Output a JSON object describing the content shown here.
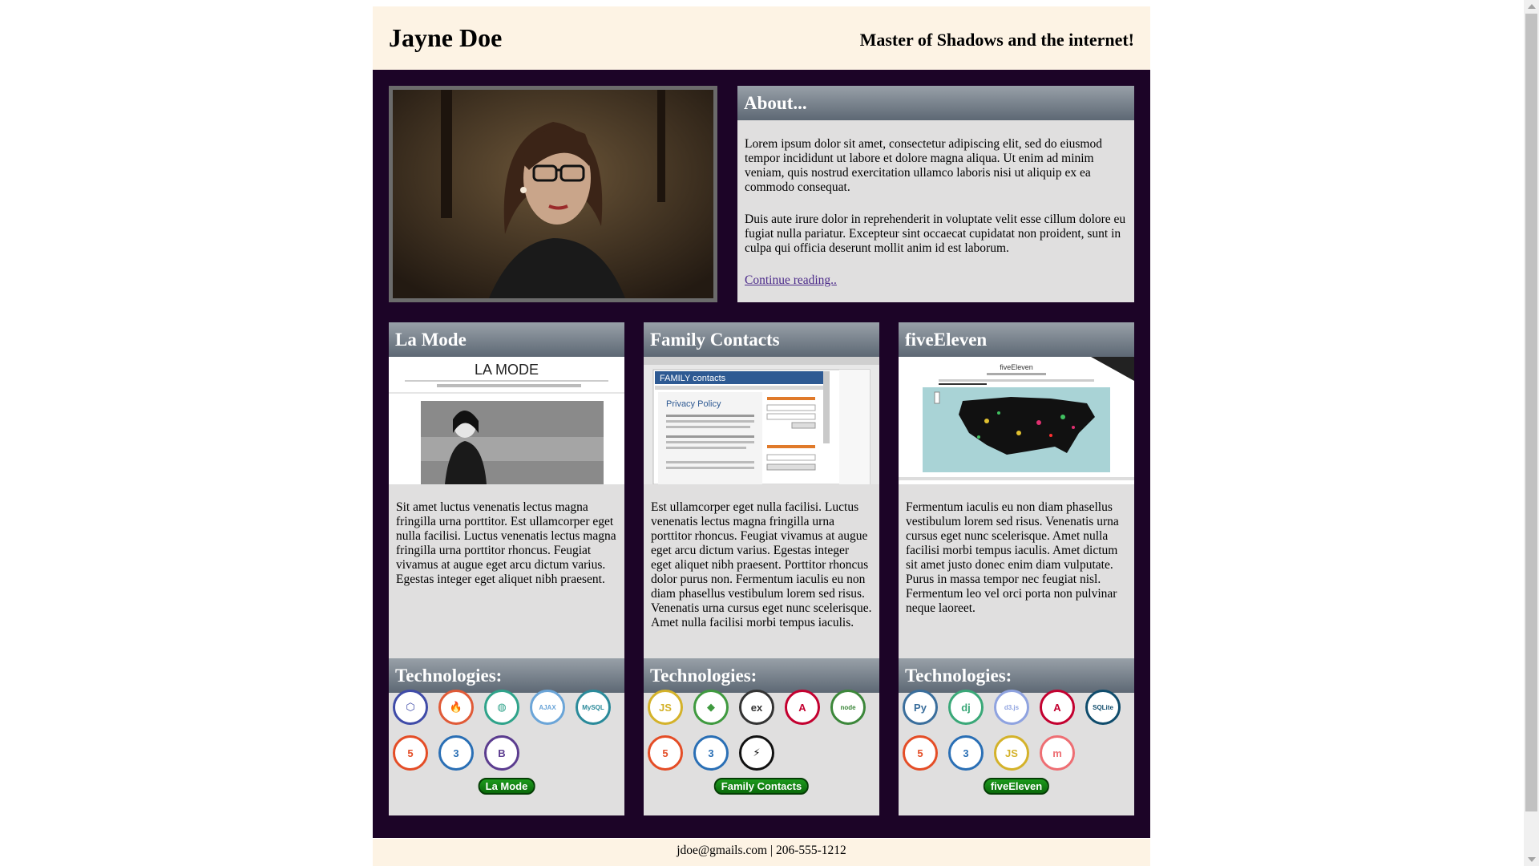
{
  "header": {
    "name": "Jayne Doe",
    "tagline": "Master of Shadows and the internet!"
  },
  "about": {
    "title": "About...",
    "p1": "Lorem ipsum dolor sit amet, consectetur adipiscing elit, sed do eiusmod tempor incididunt ut labore et dolore magna aliqua. Ut enim ad minim veniam, quis nostrud exercitation ullamco laboris nisi ut aliquip ex ea commodo consequat.",
    "p2": "Duis aute irure dolor in reprehenderit in voluptate velit esse cillum dolore eu fugiat nulla pariatur. Excepteur sint occaecat cupidatat non proident, sunt in culpa qui officia deserunt mollit anim id est laborum.",
    "link": "Continue reading.."
  },
  "projects": [
    {
      "title": "La Mode",
      "screenshot_text": "LA MODE",
      "description": "Sit amet luctus venenatis lectus magna fringilla urna porttitor. Est ullamcorper eget nulla facilisi. Luctus venenatis lectus magna fringilla urna porttitor rhoncus. Feugiat vivamus at augue eget arcu dictum varius. Egestas integer eget aliquet nibh praesent.",
      "tech_label": "Technologies:",
      "technologies": [
        {
          "name": "php-icon",
          "glyph": "⬡",
          "color": "#3f4ba8"
        },
        {
          "name": "codeigniter-icon",
          "glyph": "🔥",
          "color": "#e05a37"
        },
        {
          "name": "jquery-icon",
          "glyph": "◍",
          "color": "#2fa38a"
        },
        {
          "name": "ajax-icon",
          "glyph": "AJAX",
          "color": "#6ba5d8"
        },
        {
          "name": "mysql-icon",
          "glyph": "MySQL",
          "color": "#2a8a9a"
        },
        {
          "name": "html5-icon",
          "glyph": "5",
          "color": "#e44d26"
        },
        {
          "name": "css3-icon",
          "glyph": "3",
          "color": "#2a6fb5"
        },
        {
          "name": "bootstrap-icon",
          "glyph": "B",
          "color": "#5b3c8f"
        }
      ],
      "button": "La Mode"
    },
    {
      "title": "Family Contacts",
      "screenshot_text": "FAMILY contacts",
      "screenshot_heading": "Privacy Policy",
      "description": "Est ullamcorper eget nulla facilisi. Luctus venenatis lectus magna fringilla urna porttitor rhoncus. Feugiat vivamus at augue eget arcu dictum varius. Egestas integer eget aliquet nibh praesent. Porttitor rhoncus dolor purus non. Fermentum iaculis eu non diam phasellus vestibulum lorem sed risus. Venenatis urna cursus eget nunc scelerisque. Amet nulla facilisi morbi tempus iaculis.",
      "tech_label": "Technologies:",
      "technologies": [
        {
          "name": "javascript-icon",
          "glyph": "JS",
          "color": "#d4b22a"
        },
        {
          "name": "mongodb-icon",
          "glyph": "◆",
          "color": "#3f9a3f"
        },
        {
          "name": "express-icon",
          "glyph": "ex",
          "color": "#333333"
        },
        {
          "name": "angular-icon",
          "glyph": "A",
          "color": "#c3002f"
        },
        {
          "name": "nodejs-icon",
          "glyph": "node",
          "color": "#3c873a"
        },
        {
          "name": "html5-icon",
          "glyph": "5",
          "color": "#e44d26"
        },
        {
          "name": "css3-icon",
          "glyph": "3",
          "color": "#2a6fb5"
        },
        {
          "name": "socketio-icon",
          "glyph": "⚡",
          "color": "#111111"
        }
      ],
      "button": "Family Contacts"
    },
    {
      "title": "fiveEleven",
      "screenshot_text": "fiveEleven",
      "description": "Fermentum iaculis eu non diam phasellus vestibulum lorem sed risus. Venenatis urna cursus eget nunc scelerisque. Amet nulla facilisi morbi tempus iaculis. Amet dictum sit amet justo donec enim diam vulputate. Purus in massa tempor nec feugiat nisl. Fermentum leo vel orci porta non pulvinar neque laoreet.",
      "tech_label": "Technologies:",
      "technologies": [
        {
          "name": "python-icon",
          "glyph": "Py",
          "color": "#3a6e9c"
        },
        {
          "name": "django-icon",
          "glyph": "dj",
          "color": "#3aa878"
        },
        {
          "name": "d3js-icon",
          "glyph": "d3.js",
          "color": "#8fa3e0"
        },
        {
          "name": "angular-icon",
          "glyph": "A",
          "color": "#c3002f"
        },
        {
          "name": "sqlite-icon",
          "glyph": "SQLite",
          "color": "#0f4c6c"
        },
        {
          "name": "html5-icon",
          "glyph": "5",
          "color": "#e44d26"
        },
        {
          "name": "css3-icon",
          "glyph": "3",
          "color": "#2a6fb5"
        },
        {
          "name": "javascript-icon",
          "glyph": "JS",
          "color": "#d4b22a"
        },
        {
          "name": "materialize-icon",
          "glyph": "m",
          "color": "#ee6e73"
        }
      ],
      "button": "fiveEleven"
    }
  ],
  "footer": {
    "email": "jdoe@gmails.com",
    "separator": " | ",
    "phone": "206-555-1212"
  }
}
